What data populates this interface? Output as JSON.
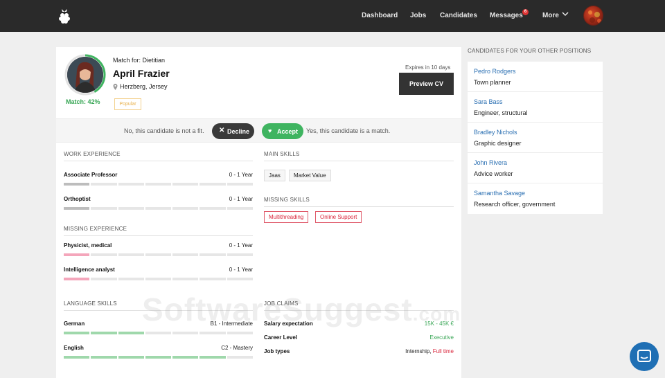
{
  "nav": {
    "items": [
      "Dashboard",
      "Jobs",
      "Candidates",
      "Messages",
      "More"
    ],
    "messages_badge": "6",
    "logo_icon": "raspberry-logo-icon",
    "more_icon": "chevron-down-icon"
  },
  "candidate": {
    "match_for": "Match for: Dietitian",
    "name": "April Frazier",
    "location": "Herzberg, Jersey",
    "match": "Match: 42%",
    "match_percent": 42,
    "tag": "Popular",
    "expires": "Expires in 10 days",
    "preview_label": "Preview CV"
  },
  "decision": {
    "no_text": "No, this candidate is not a fit.",
    "decline_label": "Decline",
    "accept_label": "Accept",
    "yes_text": "Yes, this candidate is a match."
  },
  "work_experience": {
    "title": "WORK EXPERIENCE",
    "items": [
      {
        "label": "Associate Professor",
        "value": "0 - 1 Year",
        "filled_segments": 1
      },
      {
        "label": "Orthoptist",
        "value": "0 - 1 Year",
        "filled_segments": 1
      }
    ]
  },
  "missing_experience": {
    "title": "MISSING EXPERIENCE",
    "items": [
      {
        "label": "Physicist, medical",
        "value": "0 - 1 Year",
        "filled_segments": 1
      },
      {
        "label": "Intelligence analyst",
        "value": "0 - 1 Year",
        "filled_segments": 1
      }
    ]
  },
  "main_skills": {
    "title": "MAIN SKILLS",
    "items": [
      "Jaas",
      "Market Value"
    ]
  },
  "missing_skills": {
    "title": "MISSING SKILLS",
    "items": [
      "Multithreading",
      "Online Support"
    ]
  },
  "language_skills": {
    "title": "LANGUAGE SKILLS",
    "items": [
      {
        "label": "German",
        "value": "B1 - Intermediate",
        "filled_segments": 3
      },
      {
        "label": "English",
        "value": "C2 - Mastery",
        "filled_segments": 6
      }
    ]
  },
  "job_claims": {
    "title": "JOB CLAIMS",
    "salary_label": "Salary expectation",
    "salary_value": "15K - 45K €",
    "career_label": "Career Level",
    "career_value": "Executive",
    "types_label": "Job types",
    "types_value_1": "Internship,",
    "types_value_2": "Full time"
  },
  "other_positions": {
    "title": "CANDIDATES FOR YOUR OTHER POSITIONS",
    "items": [
      {
        "name": "Pedro Rodgers",
        "role": "Town planner"
      },
      {
        "name": "Sara Bass",
        "role": "Engineer, structural"
      },
      {
        "name": "Bradley Nichols",
        "role": "Graphic designer"
      },
      {
        "name": "John Rivera",
        "role": "Advice worker"
      },
      {
        "name": "Samantha Savage",
        "role": "Research officer, government"
      }
    ]
  },
  "watermark": {
    "main": "SoftwareSuggest",
    "suffix": ".com"
  },
  "colors": {
    "accent_green": "#3fb460",
    "link_blue": "#2a6fb2",
    "missing_pink": "#f4a6bb",
    "alert_red": "#d9243a"
  },
  "icons": {
    "chat": "chat-bubble-icon",
    "location": "map-pin-icon"
  }
}
